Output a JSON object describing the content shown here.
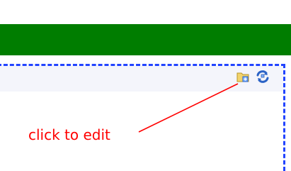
{
  "annotation": {
    "text": "click to edit",
    "color": "#ff0000"
  },
  "colors": {
    "header_bar": "#007d00",
    "panel_border": "#2244ff",
    "toolbar_bg": "#f4f5fb"
  },
  "toolbar": {
    "icons": [
      {
        "name": "edit-folder-icon"
      },
      {
        "name": "refresh-icon"
      }
    ]
  }
}
